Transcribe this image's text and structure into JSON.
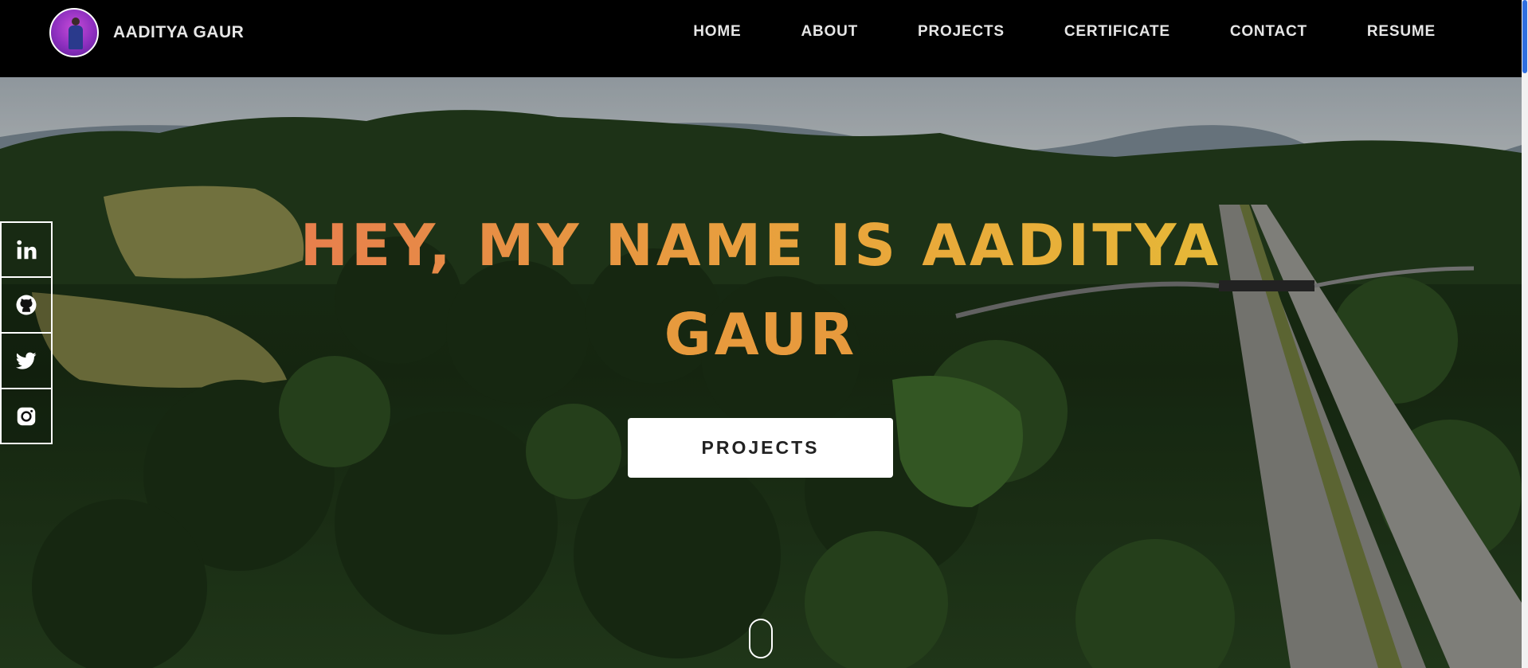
{
  "brand": {
    "name": "AADITYA GAUR",
    "avatar": "profile-photo"
  },
  "nav": {
    "items": [
      {
        "label": "HOME"
      },
      {
        "label": "ABOUT"
      },
      {
        "label": "PROJECTS"
      },
      {
        "label": "CERTIFICATE"
      },
      {
        "label": "CONTACT"
      },
      {
        "label": "RESUME"
      }
    ]
  },
  "hero": {
    "headline_line1": "HEY, MY NAME IS AADITYA",
    "headline_line2": "GAUR",
    "cta_label": "PROJECTS",
    "background": "aerial-forest-highway-photo"
  },
  "social": {
    "items": [
      {
        "icon": "linkedin-icon"
      },
      {
        "icon": "github-icon"
      },
      {
        "icon": "twitter-icon"
      },
      {
        "icon": "instagram-icon"
      }
    ]
  },
  "colors": {
    "navbar_bg": "#000000",
    "nav_text": "#e6e6e6",
    "gradient_start": "#e8665a",
    "gradient_mid": "#e9a93a",
    "gradient_end": "#e3c636",
    "cta_bg": "#ffffff",
    "scrollbar_thumb": "#2f6fe0"
  }
}
